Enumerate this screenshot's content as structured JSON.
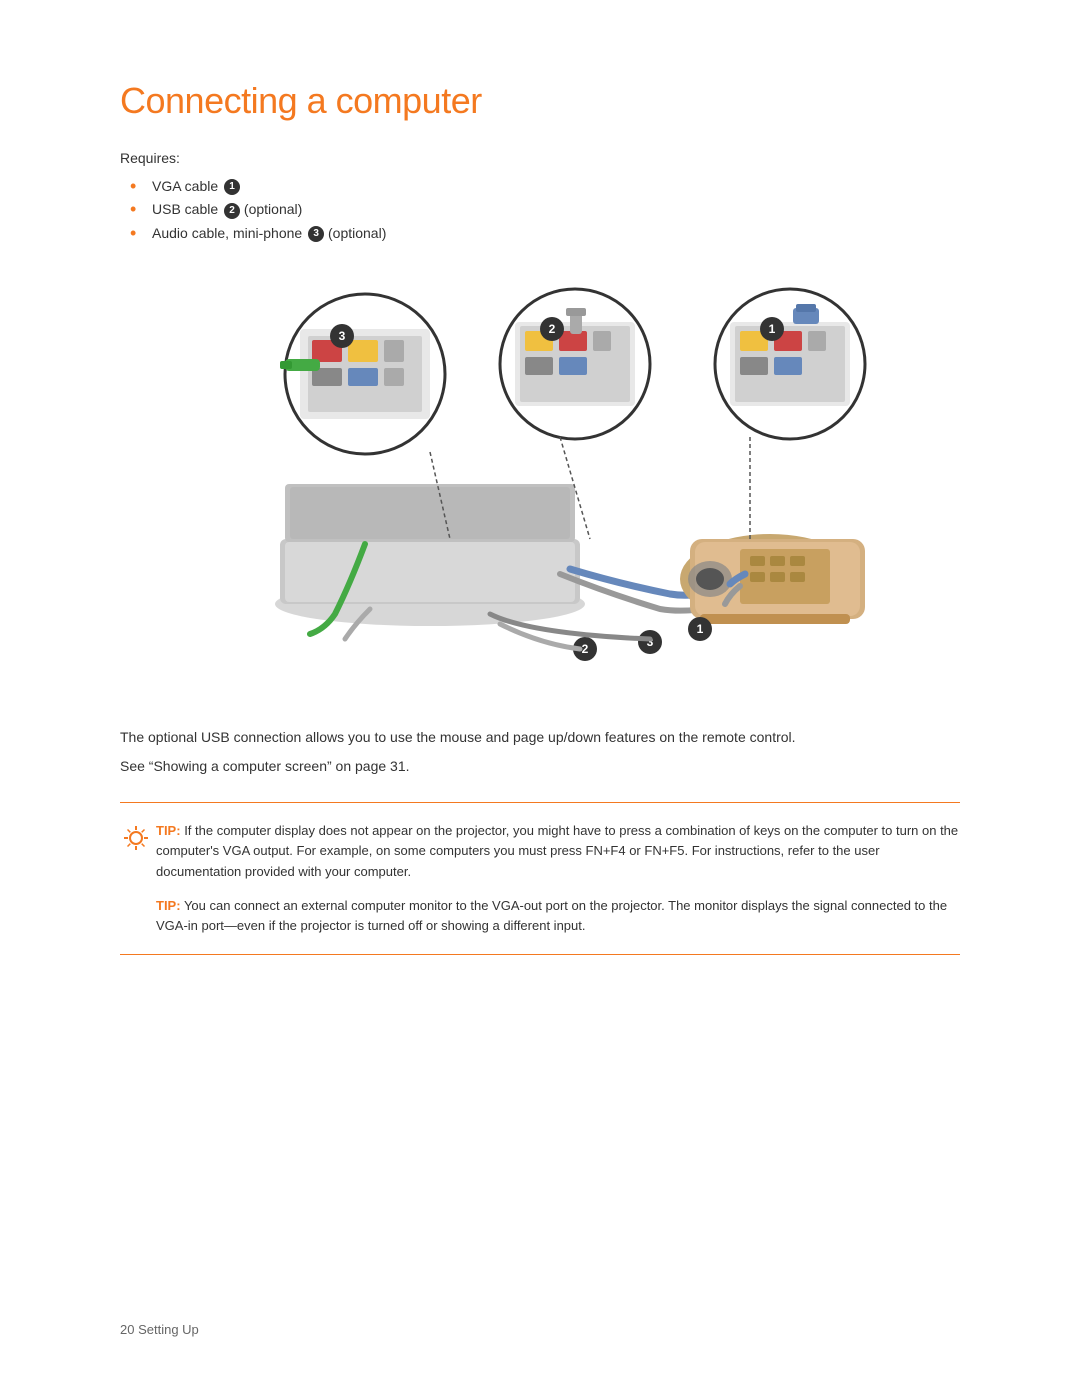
{
  "page": {
    "title": "Connecting a computer",
    "requires_label": "Requires:",
    "bullet_items": [
      {
        "text": "VGA cable",
        "num": "1",
        "suffix": ""
      },
      {
        "text": "USB cable",
        "num": "2",
        "suffix": " (optional)"
      },
      {
        "text": "Audio cable, mini-phone",
        "num": "3",
        "suffix": " (optional)"
      }
    ],
    "body_text": "The optional USB connection allows you to use the mouse and page up/down features on the remote control.",
    "see_also": "See “Showing a computer screen” on page 31.",
    "tips": [
      {
        "label": "TIP:",
        "text": "  If the computer display does not appear on the projector, you might have to press a combination of keys on the computer to turn on the computer’s VGA output. For example, on some computers you must press FN+F4 or FN+F5. For instructions, refer to the user documentation provided with your computer."
      },
      {
        "label": "TIP:",
        "text": "  You can connect an external computer monitor to the VGA-out port on the projector. The monitor displays the signal connected to the VGA-in port—even if the projector is turned off or showing a different input."
      }
    ],
    "footer": "20    Setting Up"
  }
}
